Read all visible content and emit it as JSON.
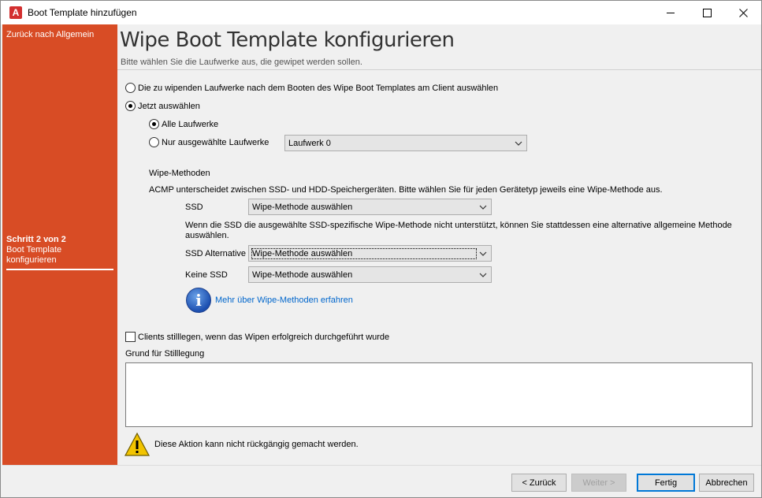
{
  "window": {
    "title": "Boot Template hinzufügen",
    "app_icon": "acmp-app-icon",
    "controls": [
      "minimize-icon",
      "maximize-icon",
      "close-icon"
    ]
  },
  "sidebar": {
    "back_link": "Zurück nach Allgemein",
    "step_label": "Schritt 2 von 2",
    "step_title": "Boot Template konfigurieren",
    "color": "#d84c25"
  },
  "header": {
    "title": "Wipe Boot Template konfigurieren",
    "subtitle": "Bitte wählen Sie die Laufwerke aus, die gewipet werden sollen."
  },
  "options": {
    "after_boot_radio": "Die zu wipenden Laufwerke nach dem Booten des Wipe Boot Templates am Client auswählen",
    "now_radio": "Jetzt auswählen",
    "selected_mode": "now",
    "all_drives_radio": "Alle Laufwerke",
    "selected_drives_radio": "Nur ausgewählte Laufwerke",
    "drive_scope": "all",
    "drive_select_value": "Laufwerk 0"
  },
  "wipe_methods": {
    "heading": "Wipe-Methoden",
    "description": "ACMP unterscheidet zwischen SSD- und HDD-Speichergeräten. Bitte wählen Sie für jeden Gerätetyp jeweils eine Wipe-Methode aus.",
    "ssd_label": "SSD",
    "ssd_value": "Wipe-Methode auswählen",
    "ssd_note": "Wenn die SSD die ausgewählte SSD-spezifische Wipe-Methode nicht unterstützt, können Sie stattdessen eine alternative allgemeine Methode auswählen.",
    "ssd_alt_label": "SSD Alternative",
    "ssd_alt_value": "Wipe-Methode auswählen",
    "no_ssd_label": "Keine SSD",
    "no_ssd_value": "Wipe-Methode auswählen",
    "more_info_link": "Mehr über Wipe-Methoden erfahren"
  },
  "decommission": {
    "checkbox_label": "Clients stilllegen, wenn das Wipen erfolgreich durchgeführt wurde",
    "checked": false,
    "reason_label": "Grund für Stilllegung",
    "reason_value": ""
  },
  "warning": {
    "text": "Diese Aktion kann nicht rückgängig gemacht werden."
  },
  "footer": {
    "back_button": "< Zurück",
    "next_button": "Weiter >",
    "finish_button": "Fertig",
    "cancel_button": "Abbrechen"
  }
}
